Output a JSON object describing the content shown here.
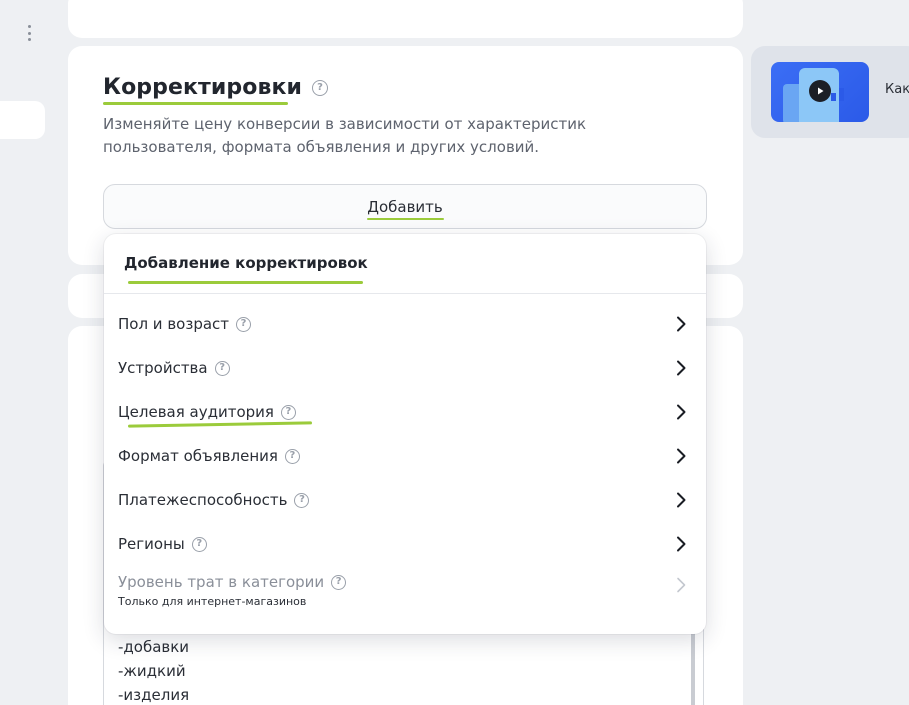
{
  "section": {
    "title": "Корректировки",
    "description": "Изменяйте цену конверсии в зависимости от характеристик пользователя, формата объявления и других условий.",
    "add_button_label": "Добавить"
  },
  "dropdown": {
    "header": "Добавление корректировок",
    "items": [
      {
        "label": "Пол и возраст",
        "sub": ""
      },
      {
        "label": "Устройства",
        "sub": ""
      },
      {
        "label": "Целевая аудитория",
        "sub": ""
      },
      {
        "label": "Формат объявления",
        "sub": ""
      },
      {
        "label": "Платежеспособность",
        "sub": ""
      },
      {
        "label": "Регионы",
        "sub": ""
      },
      {
        "label": "Уровень трат в категории",
        "sub": "Только для интернет-магазинов",
        "disabled": true
      }
    ]
  },
  "textarea": {
    "lines": [
      "-добавки",
      "-жидкий",
      "-изделия"
    ]
  },
  "side_card": {
    "text": "Как"
  },
  "colors": {
    "accent_underline": "#9bcb3b",
    "video_bg": "#2b5ae8"
  },
  "icons": [
    "help-icon",
    "chevron-right-icon",
    "play-icon",
    "more-vertical-icon"
  ]
}
